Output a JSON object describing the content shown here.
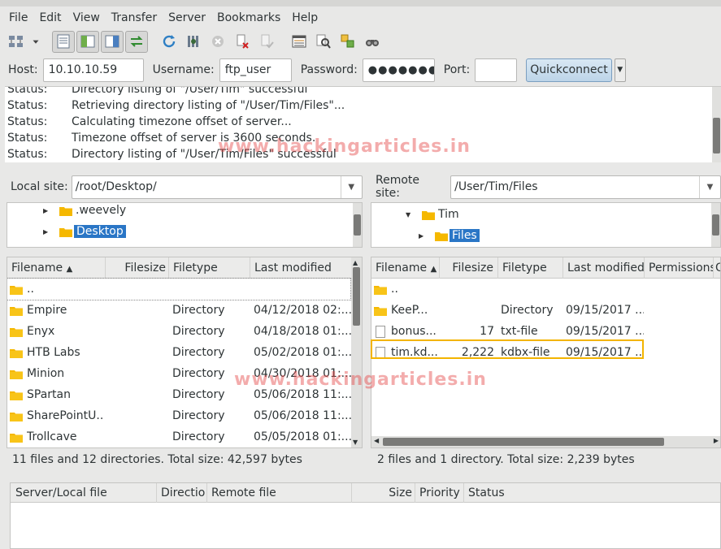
{
  "menu": [
    "File",
    "Edit",
    "View",
    "Transfer",
    "Server",
    "Bookmarks",
    "Help"
  ],
  "toolbar_icons": [
    "site-manager-icon",
    "dropdown-arrow-icon",
    "message-log-icon",
    "local-tree-icon",
    "remote-tree-icon",
    "transfer-queue-icon",
    "refresh-icon",
    "process-queue-icon",
    "cancel-icon",
    "disconnect-icon",
    "reconnect-icon",
    "directory-listing-filters-icon",
    "compare-icon",
    "sync-browse-icon",
    "search-icon"
  ],
  "quickconnect": {
    "host_label": "Host:",
    "host_value": "10.10.10.59",
    "username_label": "Username:",
    "username_value": "ftp_user",
    "password_label": "Password:",
    "password_value": "●●●●●●●●●",
    "port_label": "Port:",
    "port_value": "",
    "button": "Quickconnect"
  },
  "log": [
    {
      "k": "Status:",
      "v": "Directory listing of \"/User/Tim\" successful"
    },
    {
      "k": "Status:",
      "v": "Retrieving directory listing of \"/User/Tim/Files\"..."
    },
    {
      "k": "Status:",
      "v": "Calculating timezone offset of server..."
    },
    {
      "k": "Status:",
      "v": "Timezone offset of server is 3600 seconds."
    },
    {
      "k": "Status:",
      "v": "Directory listing of \"/User/Tim/Files\" successful"
    }
  ],
  "local": {
    "site_label": "Local site:",
    "path": "/root/Desktop/",
    "tree": [
      ".weevely",
      "Desktop"
    ],
    "columns": [
      "Filename",
      "Filesize",
      "Filetype",
      "Last modified"
    ],
    "rows": [
      {
        "name": "..",
        "size": "",
        "type": "",
        "modified": ""
      },
      {
        "name": "Empire",
        "size": "",
        "type": "Directory",
        "modified": "04/12/2018 02:..."
      },
      {
        "name": "Enyx",
        "size": "",
        "type": "Directory",
        "modified": "04/18/2018 01:..."
      },
      {
        "name": "HTB Labs",
        "size": "",
        "type": "Directory",
        "modified": "05/02/2018 01:..."
      },
      {
        "name": "Minion",
        "size": "",
        "type": "Directory",
        "modified": "04/30/2018 01:..."
      },
      {
        "name": "SPartan",
        "size": "",
        "type": "Directory",
        "modified": "05/06/2018 11:..."
      },
      {
        "name": "SharePointU...",
        "size": "",
        "type": "Directory",
        "modified": "05/06/2018 11:..."
      },
      {
        "name": "Trollcave",
        "size": "",
        "type": "Directory",
        "modified": "05/05/2018 01:..."
      }
    ],
    "status": "11 files and 12 directories. Total size: 42,597 bytes"
  },
  "remote": {
    "site_label": "Remote site:",
    "path": "/User/Tim/Files",
    "tree": [
      "Tim",
      "Files"
    ],
    "columns": [
      "Filename",
      "Filesize",
      "Filetype",
      "Last modified",
      "Permissions",
      "O"
    ],
    "rows": [
      {
        "name": "..",
        "size": "",
        "type": "",
        "modified": "",
        "kind": "folder"
      },
      {
        "name": "KeeP...",
        "size": "",
        "type": "Directory",
        "modified": "09/15/2017 ...",
        "kind": "folder"
      },
      {
        "name": "bonus...",
        "size": "17",
        "type": "txt-file",
        "modified": "09/15/2017 ...",
        "kind": "file"
      },
      {
        "name": "tim.kd...",
        "size": "2,222",
        "type": "kdbx-file",
        "modified": "09/15/2017 ...",
        "kind": "file"
      }
    ],
    "status": "2 files and 1 directory. Total size: 2,239 bytes"
  },
  "queue": {
    "columns": [
      "Server/Local file",
      "Directio",
      "Remote file",
      "Size",
      "Priority",
      "Status"
    ]
  },
  "watermark": "www.hackingarticles.in",
  "colors": {
    "selection": "#2a76c6",
    "folder": "#f5b800",
    "highlight": "#f3b400"
  }
}
